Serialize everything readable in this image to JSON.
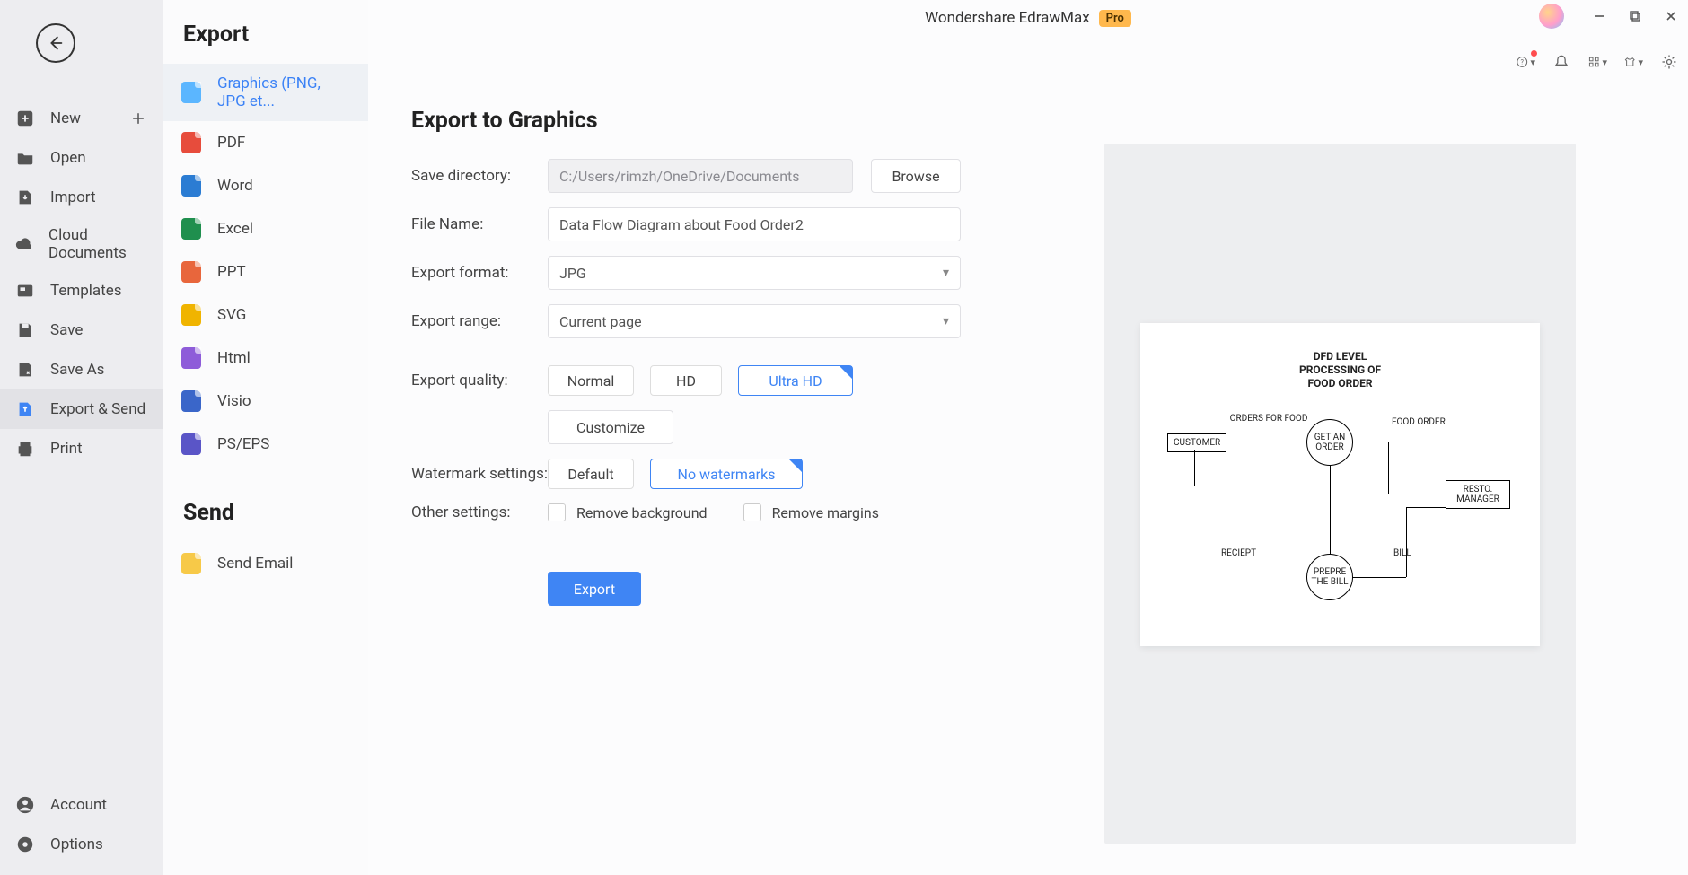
{
  "app": {
    "title": "Wondershare EdrawMax",
    "pro": "Pro"
  },
  "rail": {
    "new": "New",
    "open": "Open",
    "import": "Import",
    "cloud": "Cloud Documents",
    "templates": "Templates",
    "save": "Save",
    "saveas": "Save As",
    "exportsend": "Export & Send",
    "print": "Print",
    "account": "Account",
    "options": "Options"
  },
  "export_panel": {
    "heading": "Export",
    "items": {
      "graphics": "Graphics (PNG, JPG et...",
      "pdf": "PDF",
      "word": "Word",
      "excel": "Excel",
      "ppt": "PPT",
      "svg": "SVG",
      "html": "Html",
      "visio": "Visio",
      "pseps": "PS/EPS"
    },
    "send_heading": "Send",
    "send_email": "Send Email"
  },
  "form": {
    "heading": "Export to Graphics",
    "save_dir_label": "Save directory:",
    "save_dir_value": "C:/Users/rimzh/OneDrive/Documents",
    "browse": "Browse",
    "file_name_label": "File Name:",
    "file_name_value": "Data Flow Diagram about Food Order2",
    "format_label": "Export format:",
    "format_value": "JPG",
    "range_label": "Export range:",
    "range_value": "Current page",
    "quality_label": "Export quality:",
    "quality_normal": "Normal",
    "quality_hd": "HD",
    "quality_uhd": "Ultra HD",
    "customize": "Customize",
    "watermark_label": "Watermark settings:",
    "watermark_default": "Default",
    "watermark_none": "No watermarks",
    "other_label": "Other settings:",
    "remove_bg": "Remove background",
    "remove_margins": "Remove margins",
    "export_btn": "Export"
  },
  "preview": {
    "title_l1": "DFD LEVEL",
    "title_l2": "PROCESSING OF",
    "title_l3": "FOOD ORDER",
    "orders_for_food": "ORDERS FOR FOOD",
    "food_order": "FOOD ORDER",
    "customer": "CUSTOMER",
    "get_an_order": "GET AN ORDER",
    "resto_manager": "RESTO. MANAGER",
    "receipt": "RECIEPT",
    "bill": "BILL",
    "prepare_bill": "PREPRE THE BILL"
  }
}
